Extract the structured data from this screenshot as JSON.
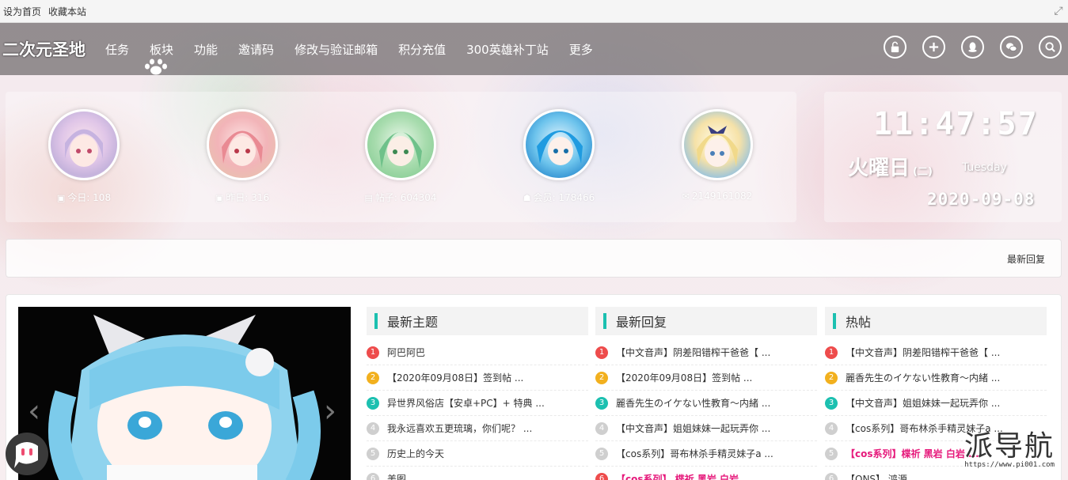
{
  "topbar": {
    "set_home": "设为首页",
    "bookmark": "收藏本站"
  },
  "nav": {
    "logo": "二次元圣地",
    "items": [
      "任务",
      "板块",
      "功能",
      "邀请码",
      "修改与验证邮箱",
      "积分充值",
      "300英雄补丁站",
      "更多"
    ],
    "icons": [
      "unlock-icon",
      "plus-icon",
      "qq-icon",
      "wechat-icon",
      "search-icon"
    ]
  },
  "stats": [
    {
      "icon": "calendar-icon",
      "label": "今日: 108"
    },
    {
      "icon": "calendar-icon",
      "label": "昨日: 316"
    },
    {
      "icon": "chart-icon",
      "label": "帖子: 604304"
    },
    {
      "icon": "users-icon",
      "label": "会员: 178466"
    },
    {
      "icon": "chat-icon",
      "label": "2149161082"
    }
  ],
  "clock": {
    "time": "11:47:57",
    "day": "火曜日",
    "day_num": "(二)",
    "day_en": "Tuesday",
    "date": "2020-09-08"
  },
  "ticker": {
    "label": "最新回复"
  },
  "columns": [
    {
      "title": "最新主题",
      "items": [
        "阿巴阿巴",
        "【2020年09月08日】签到帖 ...",
        "异世界风俗店【安卓+PC】+ 特典 ...",
        "我永远喜欢五更琉璃，你们呢？ ...",
        "历史上的今天",
        "美图"
      ]
    },
    {
      "title": "最新回复",
      "items": [
        "【中文音声】阴差阳错榨干爸爸【 ...",
        "【2020年09月08日】签到帖 ...",
        "麗香先生のイケない性教育～内緒 ...",
        "【中文音声】姐姐妹妹一起玩弄你 ...",
        "【cos系列】哥布林杀手精灵妹子a ...",
        "【cos系列】 楪祈 黑岩 白岩 ..."
      ]
    },
    {
      "title": "热帖",
      "items": [
        "【中文音声】阴差阳错榨干爸爸【 ...",
        "麗香先生のイケない性教育～内緒 ...",
        "【中文音声】姐姐妹妹一起玩弄你 ...",
        "【cos系列】哥布林杀手精灵妹子a ...",
        "【cos系列】楪祈 黑岩 白岩 ...",
        "【ONS】 鸿源 ..."
      ]
    }
  ],
  "watermark": {
    "big": "派导航",
    "small": "https://www.pi001.com"
  },
  "colors": {
    "teal": "#1cc0b0",
    "red": "#ee4c4c",
    "yellow": "#f2b01e",
    "pink": "#e6197b"
  }
}
